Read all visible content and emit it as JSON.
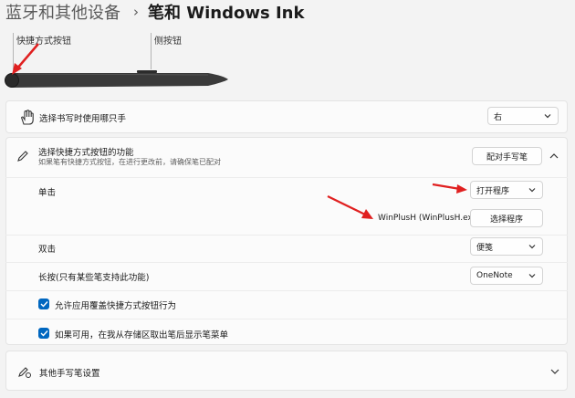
{
  "breadcrumb": {
    "parent": "蓝牙和其他设备",
    "separator": "›",
    "current": "笔和 Windows Ink"
  },
  "pen_diagram": {
    "shortcut_button_label": "快捷方式按钮",
    "side_button_label": "侧按钮"
  },
  "handedness": {
    "label": "选择书写时使用哪只手",
    "value": "右"
  },
  "shortcut": {
    "title": "选择快捷方式按钮的功能",
    "subtitle": "如果笔有快捷方式按钮，在进行更改前，请确保笔已配对",
    "pair_button": "配对手写笔",
    "single_click_label": "单击",
    "single_click_value": "打开程序",
    "program_name": "WinPlusH (WinPlusH.exe)",
    "choose_program_button": "选择程序",
    "double_click_label": "双击",
    "double_click_value": "便笺",
    "long_press_label": "长按(只有某些笔支持此功能)",
    "long_press_value": "OneNote",
    "checkbox1_label": "允许应用覆盖快捷方式按钮行为",
    "checkbox1_checked": true,
    "checkbox2_label": "如果可用，在我从存储区取出笔后显示笔菜单",
    "checkbox2_checked": true
  },
  "other_settings": {
    "label": "其他手写笔设置"
  },
  "colors": {
    "accent": "#0067c0",
    "annotation_arrow": "#e02020"
  }
}
